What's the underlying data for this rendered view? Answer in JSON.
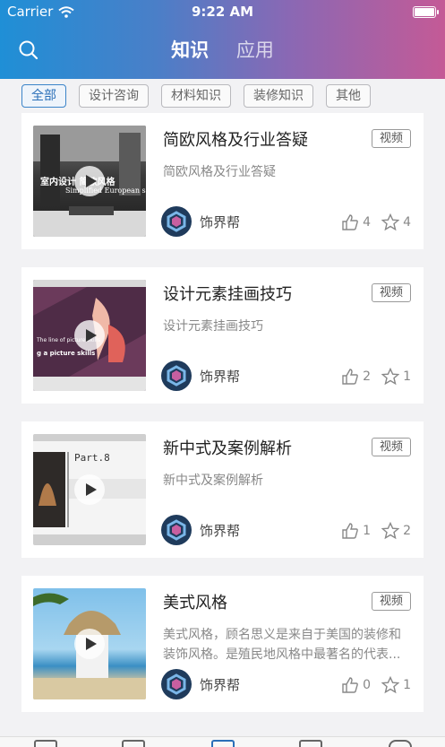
{
  "status_bar": {
    "carrier": "Carrier",
    "time": "9:22 AM"
  },
  "header": {
    "tabs": [
      {
        "label": "知识",
        "active": true
      },
      {
        "label": "应用",
        "active": false
      }
    ]
  },
  "filters": [
    {
      "label": "全部",
      "active": true
    },
    {
      "label": "设计咨询",
      "active": false
    },
    {
      "label": "材料知识",
      "active": false
    },
    {
      "label": "装修知识",
      "active": false
    },
    {
      "label": "其他",
      "active": false
    }
  ],
  "cards": [
    {
      "title": "简欧风格及行业答疑",
      "badge": "视频",
      "desc": "简欧风格及行业答疑",
      "author": "饰界帮",
      "likes": "4",
      "favorites": "4"
    },
    {
      "title": "设计元素挂画技巧",
      "badge": "视频",
      "desc": "设计元素挂画技巧",
      "author": "饰界帮",
      "likes": "2",
      "favorites": "1"
    },
    {
      "title": "新中式及案例解析",
      "badge": "视频",
      "desc": "新中式及案例解析",
      "author": "饰界帮",
      "likes": "1",
      "favorites": "2"
    },
    {
      "title": "美式风格",
      "badge": "视频",
      "desc": "美式风格，顾名思义是来自于美国的装修和装饰风格。是殖民地风格中最著名的代表...",
      "author": "饰界帮",
      "likes": "0",
      "favorites": "1"
    }
  ],
  "thumb_text": {
    "card1_line1": "室内设计  简欧风格",
    "card1_line2": "Simplified European s",
    "card2_line1": "The line of picture skills",
    "card2_line2": "g a picture skills",
    "card3_line1": "Part.8"
  },
  "colors": {
    "accent": "#2a6fb8",
    "header_start": "#1f8fd6",
    "header_end": "#c45a96"
  }
}
